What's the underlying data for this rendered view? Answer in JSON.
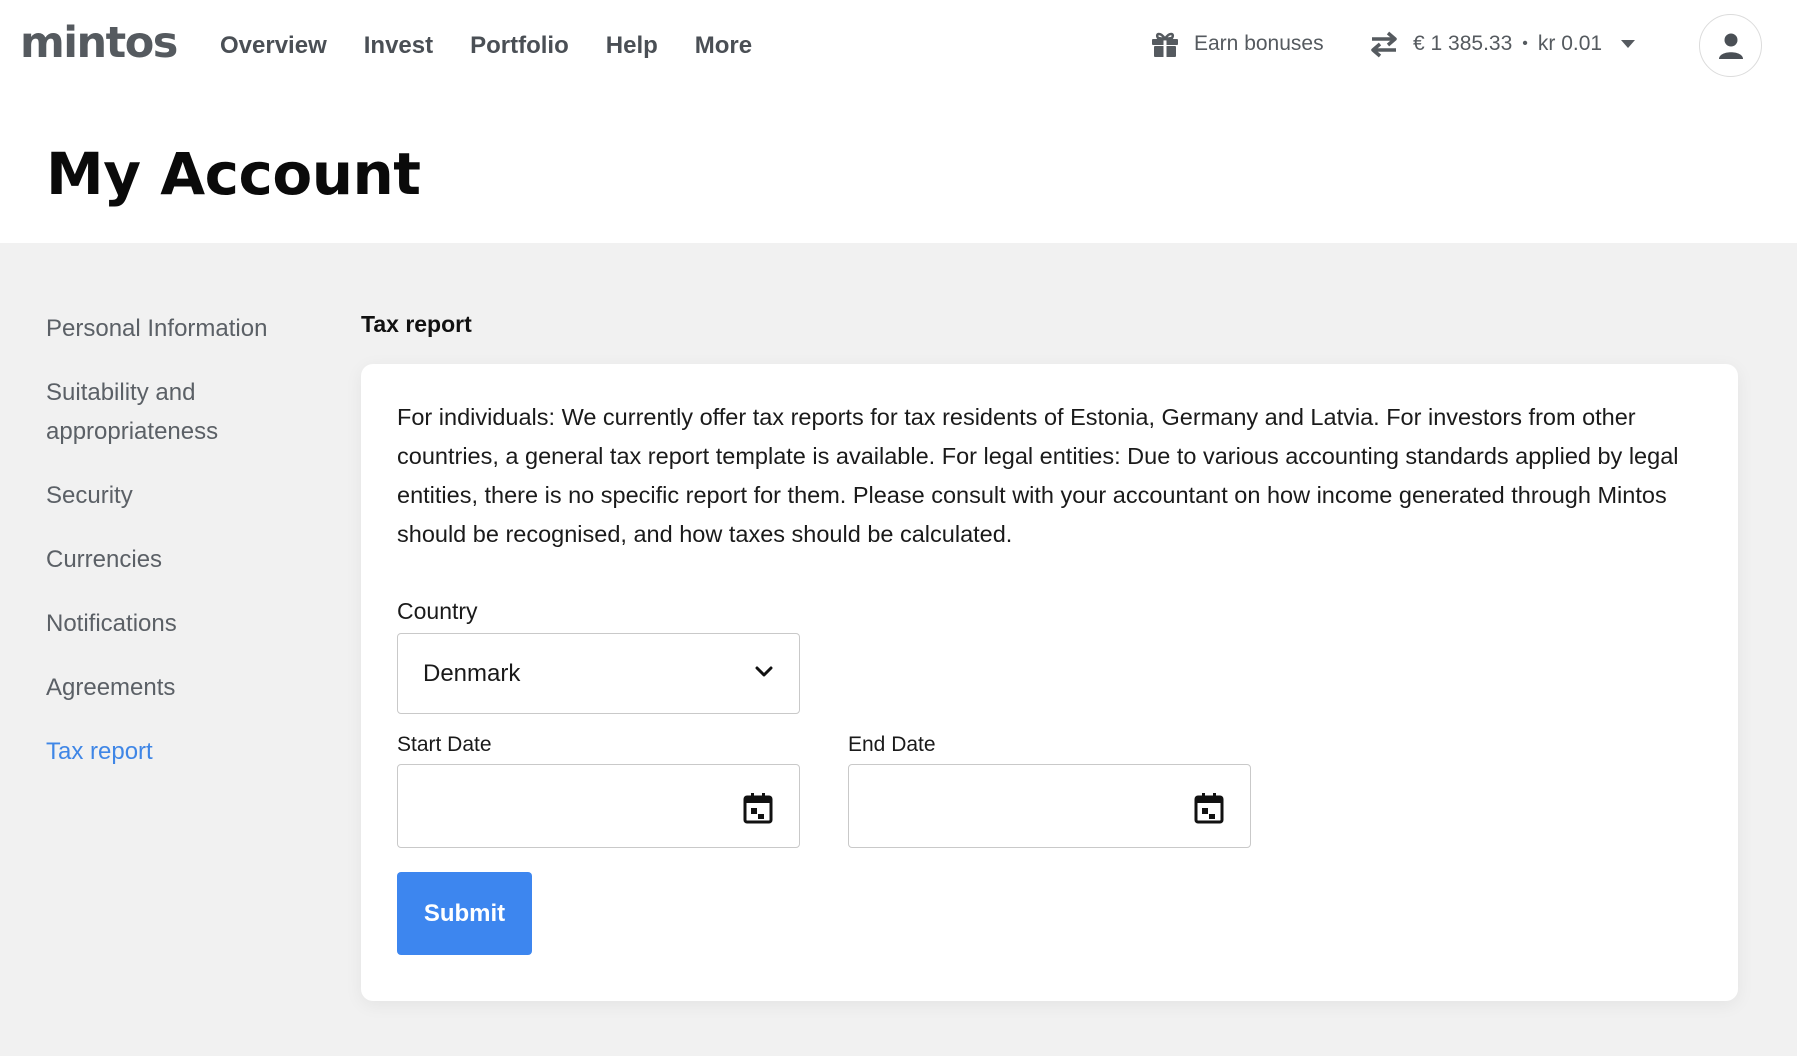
{
  "brand": {
    "logo": "mintos"
  },
  "nav": {
    "items": [
      "Overview",
      "Invest",
      "Portfolio",
      "Help",
      "More"
    ]
  },
  "header": {
    "earn_bonuses": "Earn bonuses",
    "balance_eur": "€ 1 385.33",
    "separator": "•",
    "balance_dkk": "kr 0.01"
  },
  "page": {
    "title": "My Account"
  },
  "sidebar": {
    "items": [
      {
        "label": "Personal Information"
      },
      {
        "label": "Suitability and appropriateness"
      },
      {
        "label": "Security"
      },
      {
        "label": "Currencies"
      },
      {
        "label": "Notifications"
      },
      {
        "label": "Agreements"
      },
      {
        "label": "Tax report",
        "active": true
      }
    ]
  },
  "tax_report": {
    "title": "Tax report",
    "info": "For individuals: We currently offer tax reports for tax residents of Estonia, Germany and Latvia. For investors from other countries, a general tax report template is available. For legal entities: Due to various accounting standards applied by legal entities, there is no specific report for them. Please consult with your accountant on how income generated through Mintos should be recognised, and how taxes should be calculated.",
    "country_label": "Country",
    "country_value": "Denmark",
    "start_date_label": "Start Date",
    "start_date_value": "",
    "end_date_label": "End Date",
    "end_date_value": "",
    "submit_label": "Submit"
  },
  "colors": {
    "accent": "#3d86ef",
    "active_link": "#3f86e6",
    "content_bg": "#f1f1f1"
  },
  "icons": [
    "gift-icon",
    "swap-arrows-icon",
    "caret-down-icon",
    "user-icon",
    "chevron-down-icon",
    "calendar-icon"
  ]
}
